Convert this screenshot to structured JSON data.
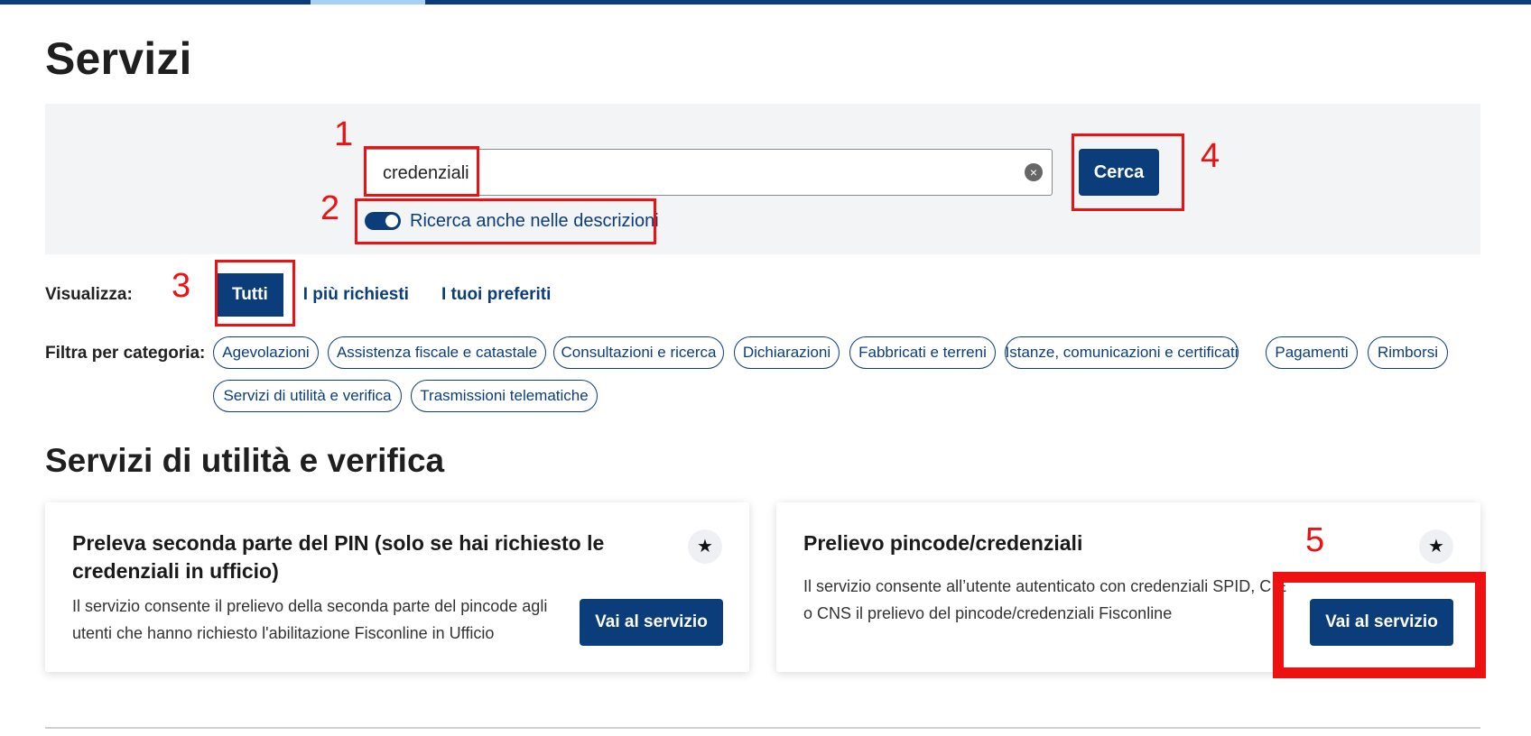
{
  "page_title": "Servizi",
  "search": {
    "value": "credenziali",
    "clear_icon": "×",
    "button_label": "Cerca",
    "toggle_label": "Ricerca anche nelle descrizioni"
  },
  "view": {
    "label": "Visualizza:",
    "tabs": [
      {
        "label": "Tutti",
        "active": true
      },
      {
        "label": "I più richiesti",
        "active": false
      },
      {
        "label": "I tuoi preferiti",
        "active": false
      }
    ]
  },
  "filter": {
    "label": "Filtra per categoria:",
    "chips": [
      "Agevolazioni",
      "Assistenza fiscale e catastale",
      "Consultazioni e ricerca",
      "Dichiarazioni",
      "Fabbricati e terreni",
      "Istanze, comunicazioni e certificati",
      "Pagamenti",
      "Rimborsi",
      "Servizi di utilità e verifica",
      "Trasmissioni telematiche"
    ]
  },
  "section_title": "Servizi di utilità e verifica",
  "cards": [
    {
      "title": "Preleva seconda parte del PIN (solo se hai richiesto le credenziali in ufficio)",
      "description": "Il servizio consente il prelievo della seconda parte del pincode agli utenti che hanno richiesto l'abilitazione Fisconline in Ufficio",
      "button_label": "Vai al servizio",
      "star_icon": "★"
    },
    {
      "title": "Prelievo pincode/credenziali",
      "description": "Il servizio consente all’utente autenticato con credenziali SPID, CIE o CNS il prelievo del pincode/credenziali Fisconline",
      "button_label": "Vai al servizio",
      "star_icon": "★"
    }
  ],
  "annotations": [
    "1",
    "2",
    "3",
    "4",
    "5"
  ],
  "colors": {
    "primary": "#0b3d7a",
    "panel_bg": "#f3f4f6",
    "annotation_red": "#ee1111",
    "accent_light_blue": "#a6d1f5"
  }
}
